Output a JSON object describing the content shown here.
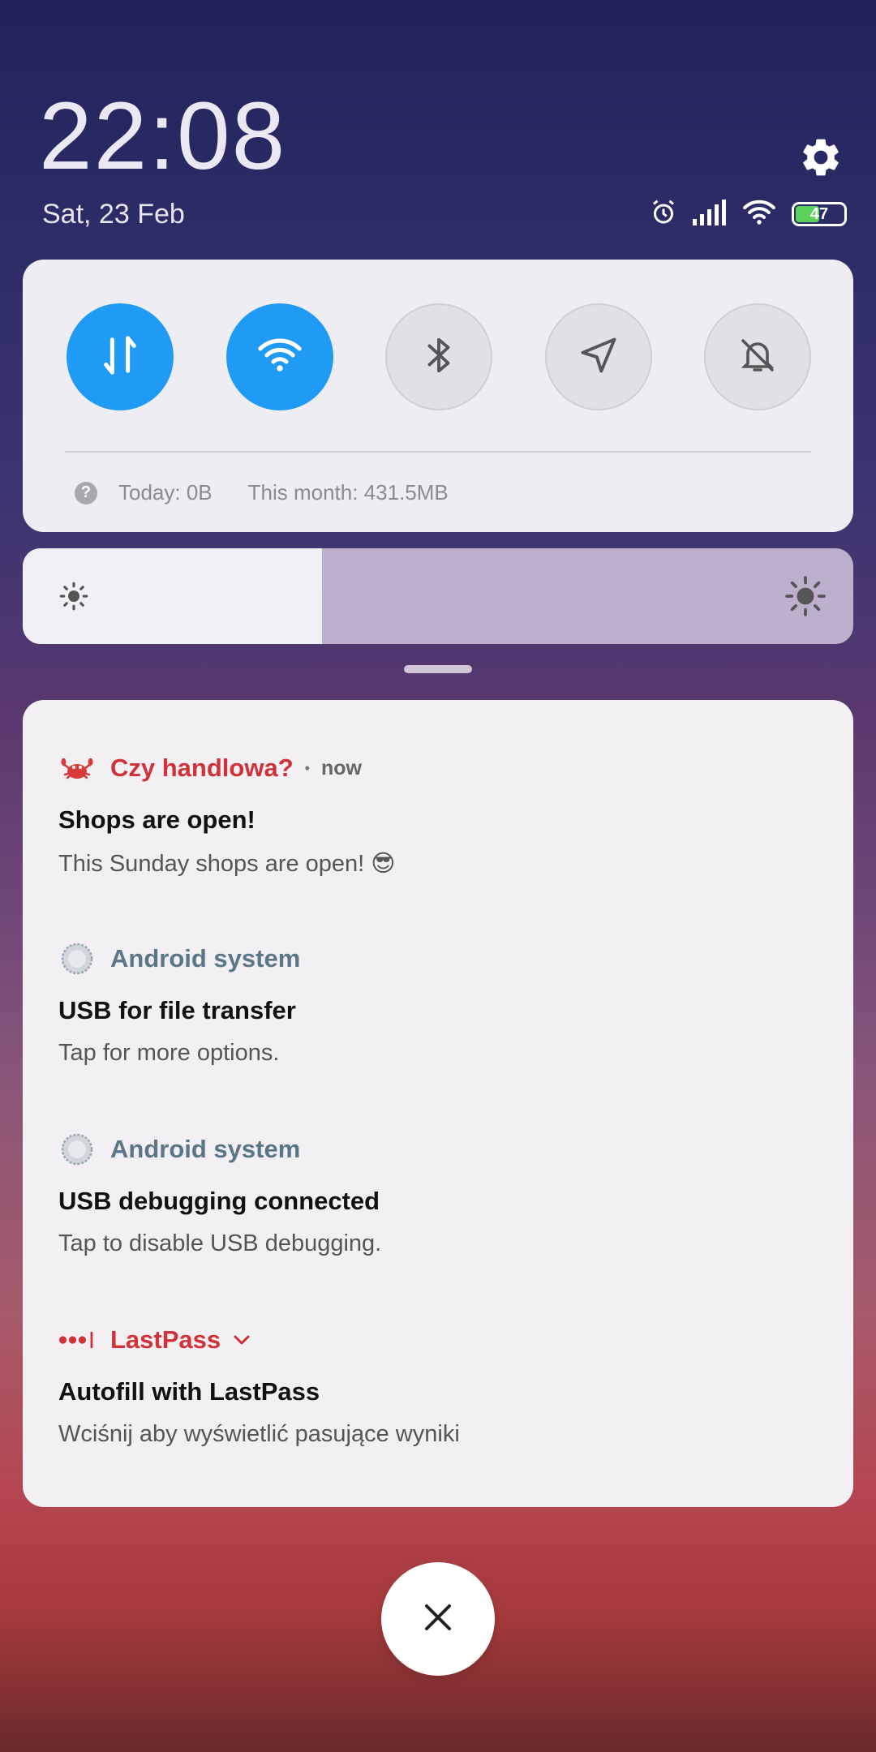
{
  "status": {
    "time": "22:08",
    "date": "Sat, 23 Feb",
    "battery_level": "47",
    "icons": [
      "alarm-icon",
      "signal-icon",
      "wifi-icon",
      "battery-icon"
    ]
  },
  "quick_settings": {
    "toggles": [
      {
        "name": "mobile-data",
        "icon": "arrows-updown-icon",
        "state": "on"
      },
      {
        "name": "wifi",
        "icon": "wifi-icon",
        "state": "on"
      },
      {
        "name": "bluetooth",
        "icon": "bluetooth-icon",
        "state": "off"
      },
      {
        "name": "location",
        "icon": "location-arrow-icon",
        "state": "off"
      },
      {
        "name": "silent",
        "icon": "bell-off-icon",
        "state": "off"
      }
    ],
    "data_today": "Today: 0B",
    "data_month": "This month: 431.5MB",
    "accent_color": "#1f9bf5"
  },
  "brightness": {
    "level": 0.36
  },
  "notifications": [
    {
      "app": "Czy handlowa?",
      "time": "now",
      "icon": "crab-icon",
      "title": "Shops are open!",
      "body": "This Sunday shops are open! 😎"
    },
    {
      "app": "Android system",
      "icon": "android-system-icon",
      "title": "USB for file transfer",
      "body": "Tap for more options."
    },
    {
      "app": "Android system",
      "icon": "android-system-icon",
      "title": "USB debugging connected",
      "body": "Tap to disable USB debugging."
    },
    {
      "app": "LastPass",
      "icon": "lastpass-icon",
      "title": "Autofill with LastPass",
      "body": "Wciśnij aby wyświetlić pasujące wyniki"
    }
  ]
}
